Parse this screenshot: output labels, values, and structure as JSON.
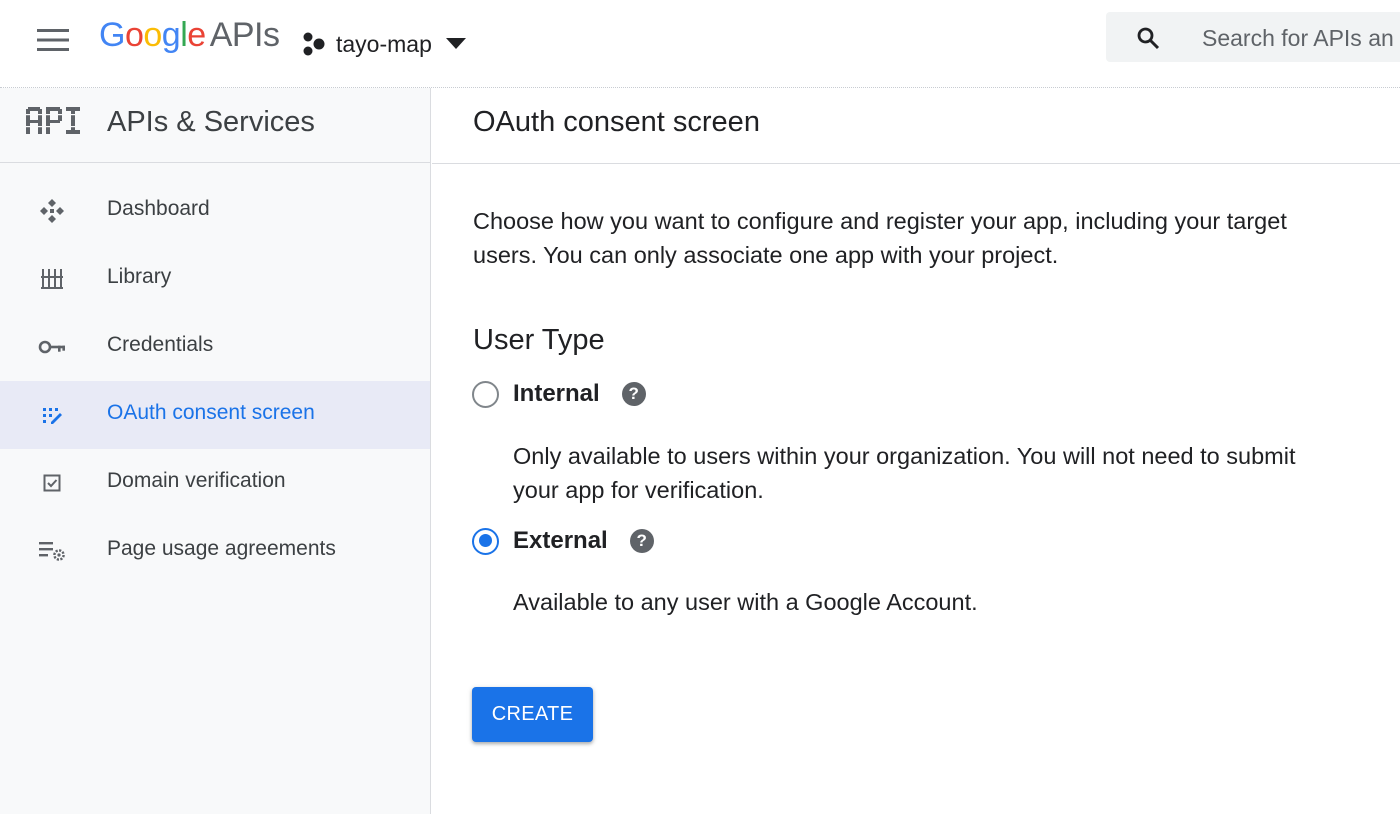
{
  "header": {
    "logo_brand": "Google",
    "logo_product": "APIs",
    "project_name": "tayo-map",
    "search_placeholder": "Search for APIs an"
  },
  "sidebar": {
    "title": "APIs & Services",
    "logo_text": "API",
    "items": [
      {
        "label": "Dashboard",
        "icon": "dashboard-icon"
      },
      {
        "label": "Library",
        "icon": "library-icon"
      },
      {
        "label": "Credentials",
        "icon": "key-icon"
      },
      {
        "label": "OAuth consent screen",
        "icon": "oauth-icon",
        "active": true
      },
      {
        "label": "Domain verification",
        "icon": "checkbox-icon"
      },
      {
        "label": "Page usage agreements",
        "icon": "settings-list-icon"
      }
    ]
  },
  "main": {
    "title": "OAuth consent screen",
    "intro": "Choose how you want to configure and register your app, including your target users. You can only associate one app with your project.",
    "user_type_title": "User Type",
    "options": [
      {
        "label": "Internal",
        "help": "?",
        "description": "Only available to users within your organization. You will not need to submit your app for verification.",
        "selected": false
      },
      {
        "label": "External",
        "help": "?",
        "description": "Available to any user with a Google Account.",
        "selected": true
      }
    ],
    "create_label": "CREATE"
  },
  "colors": {
    "accent": "#1a73e8",
    "sidebar_bg": "#f8f9fa",
    "active_bg": "#e8eaf6"
  }
}
